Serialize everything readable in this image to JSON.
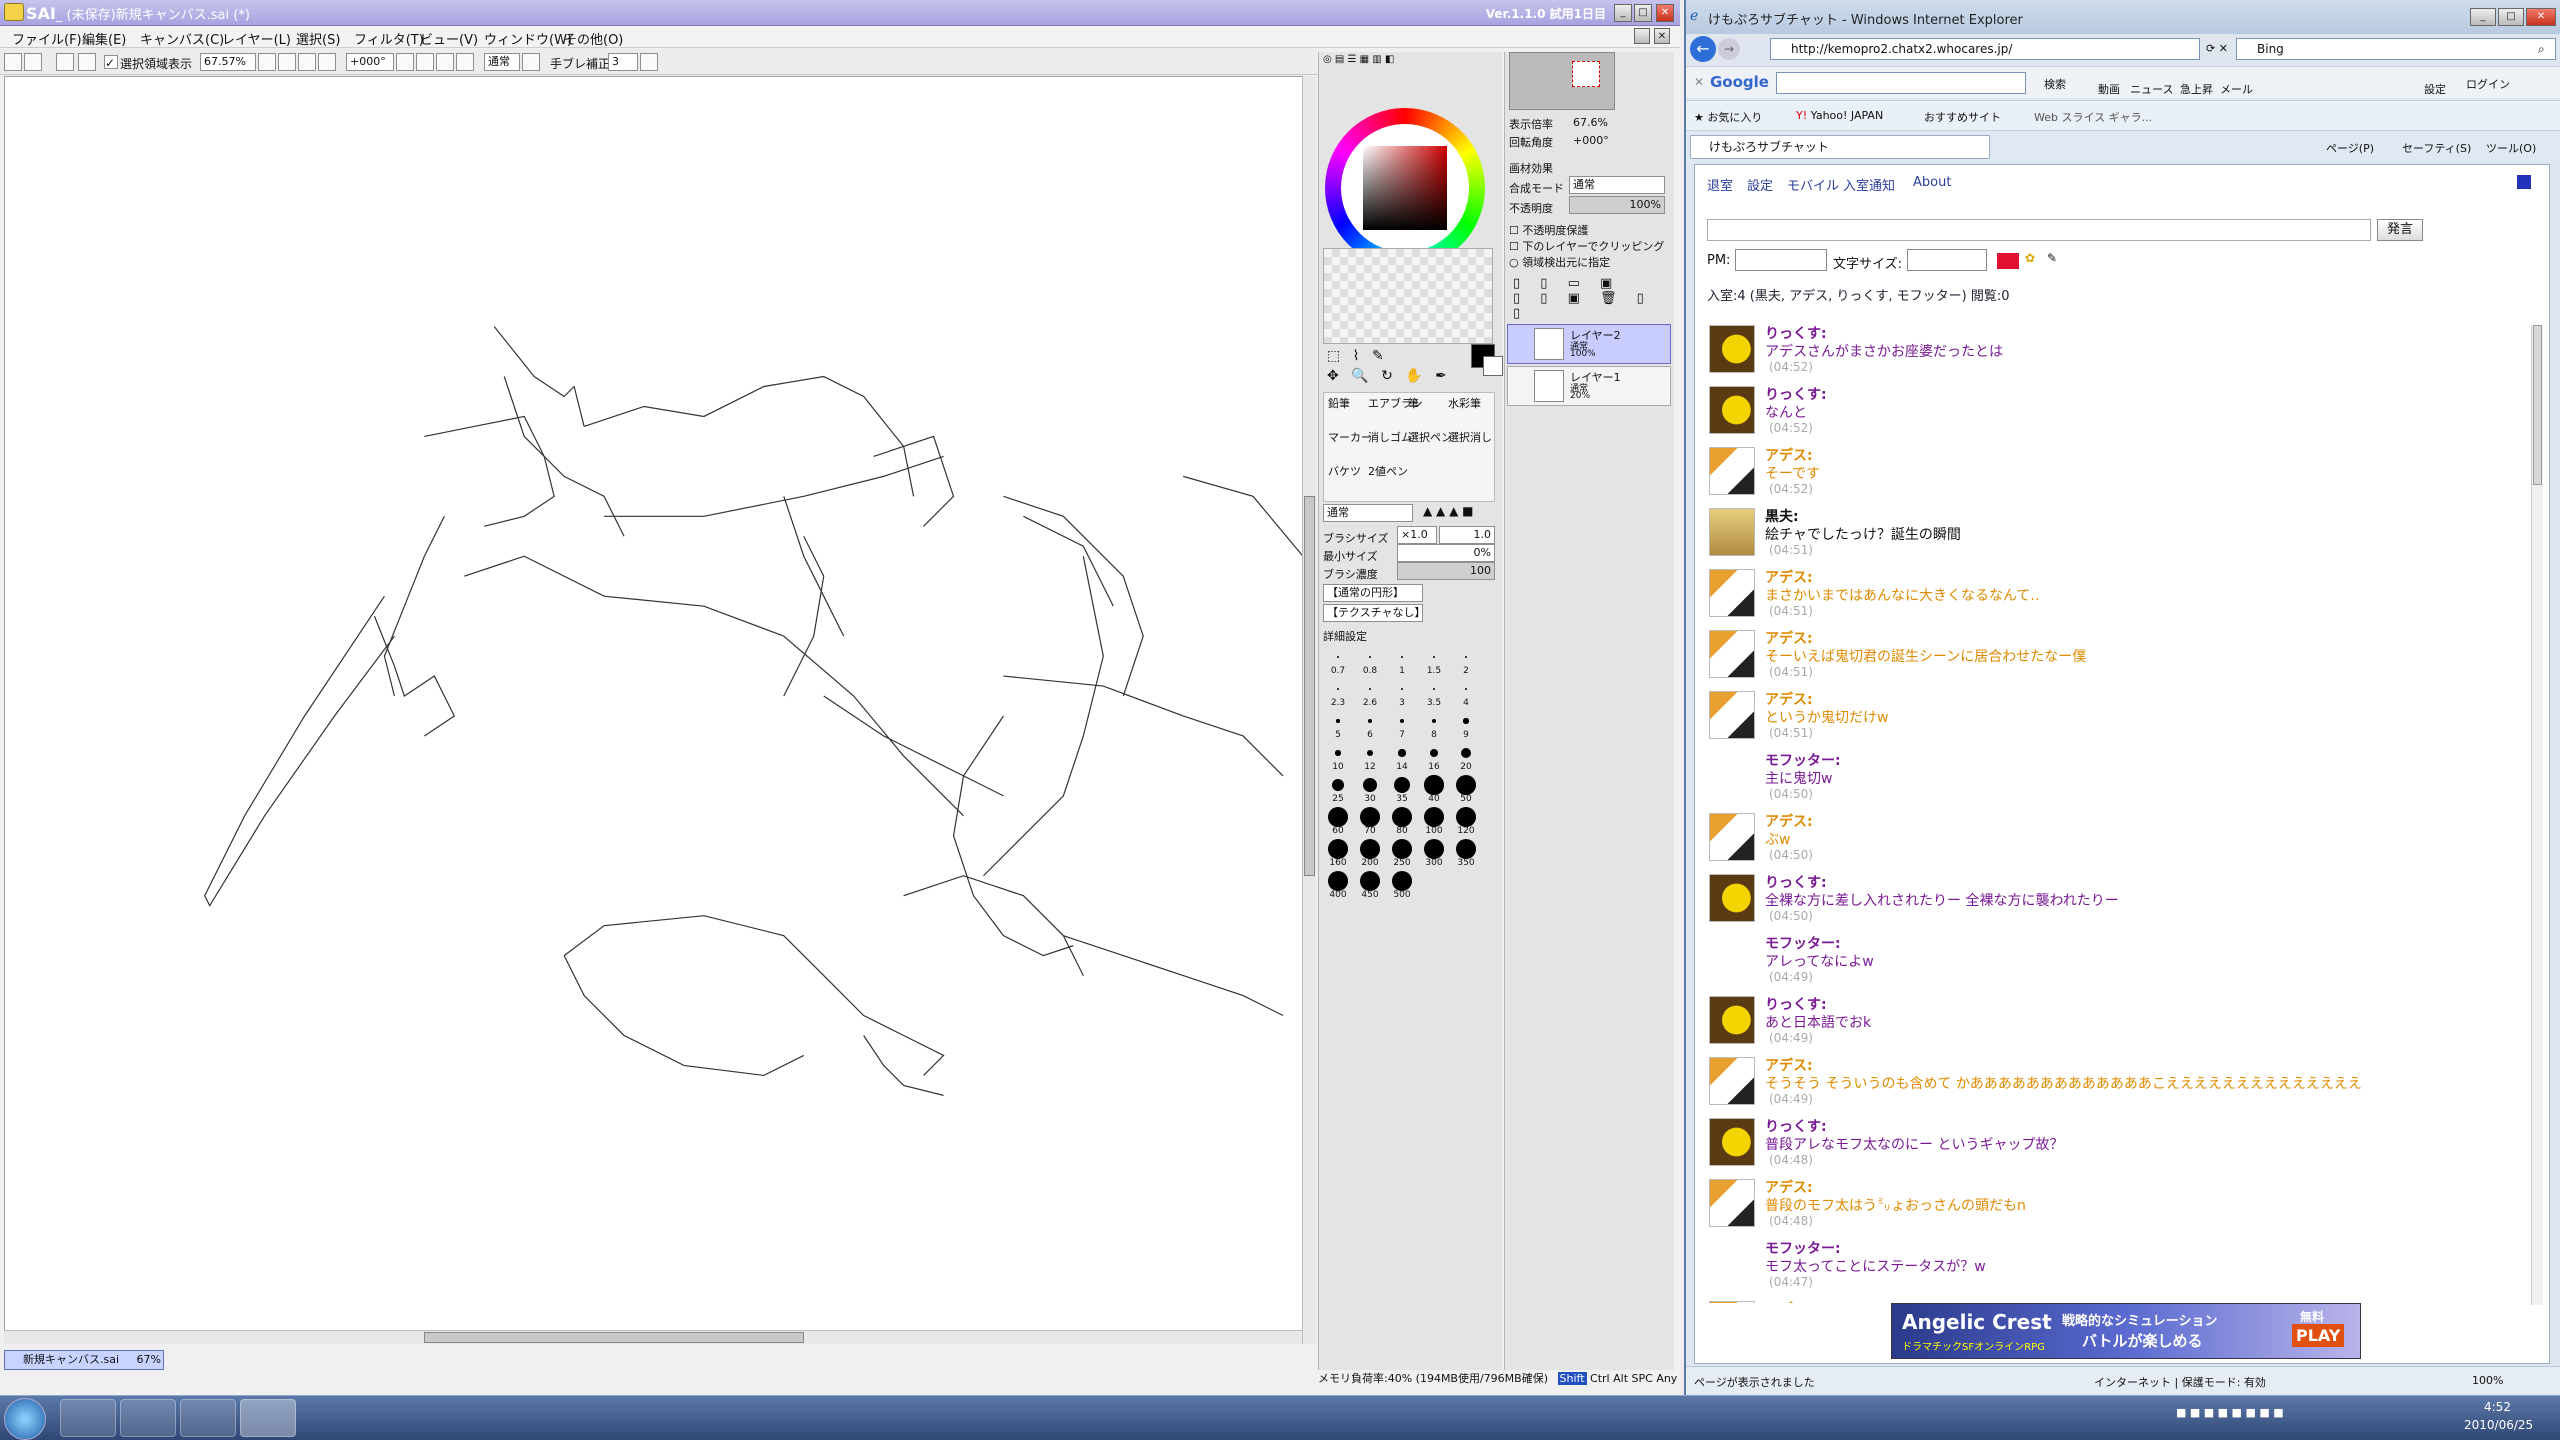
{
  "sai": {
    "title": "(未保存)新規キャンバス.sai (*)",
    "logo_text": "SAI",
    "version": "Ver.1.1.0 試用1日目",
    "menu": [
      "ファイル(F)",
      "編集(E)",
      "キャンバス(C)",
      "レイヤー(L)",
      "選択(S)",
      "フィルタ(T)",
      "ビュー(V)",
      "ウィンドウ(W)",
      "その他(O)"
    ],
    "toolbar": {
      "selection_show": "選択領域表示",
      "zoom": "67.57%",
      "angle": "+000°",
      "blend": "通常",
      "stabilizer_label": "手ブレ補正",
      "stabilizer_value": "3"
    },
    "nav": {
      "display_scale_label": "表示倍率",
      "display_scale": "67.6%",
      "rotation_label": "回転角度",
      "rotation": "+000°"
    },
    "layer_props": {
      "paper_effect": "画材効果",
      "blend_label": "合成モード",
      "blend": "通常",
      "opacity_label": "不透明度",
      "opacity": "100%",
      "preserve_opacity": "不透明度保護",
      "clip": "下のレイヤーでクリッピング",
      "select_source": "領域検出元に指定"
    },
    "layers": [
      {
        "name": "レイヤー2",
        "mode": "通常",
        "opacity": "100%"
      },
      {
        "name": "レイヤー1",
        "mode": "通常",
        "opacity": "20%"
      }
    ],
    "tools": [
      "鉛筆",
      "エアブラシ",
      "筆",
      "水彩筆",
      "マーカー",
      "消しゴム",
      "選択ペン",
      "選択消し",
      "バケツ",
      "2値ペン"
    ],
    "brush": {
      "mode": "通常",
      "size_label": "ブラシサイズ",
      "size_mult": "×1.0",
      "size": "1.0",
      "min_label": "最小サイズ",
      "min": "0%",
      "density_label": "ブラシ濃度",
      "density": "100",
      "shape": "【通常の円形】",
      "texture": "【テクスチャなし】",
      "detail": "詳細設定"
    },
    "sizes": [
      "0.7",
      "0.8",
      "1",
      "1.5",
      "2",
      "2.3",
      "2.6",
      "3",
      "3.5",
      "4",
      "5",
      "6",
      "7",
      "8",
      "9",
      "10",
      "12",
      "14",
      "16",
      "20",
      "25",
      "30",
      "35",
      "40",
      "50",
      "60",
      "70",
      "80",
      "100",
      "120",
      "160",
      "200",
      "250",
      "300",
      "350",
      "400",
      "450",
      "500"
    ],
    "tab_name": "新規キャンバス.sai",
    "tab_zoom": "67%",
    "memory": "メモリ負荷率:40% (194MB使用/796MB確保)",
    "status_keys": [
      "Shift",
      "Ctrl",
      "Alt",
      "SPC",
      "Any"
    ]
  },
  "ie": {
    "title": "けもぷろサブチャット - Windows Internet Explorer",
    "url": "http://kemopro2.chatx2.whocares.jp/",
    "search_engine": "Bing",
    "google": "Google",
    "gbar": [
      "検索",
      "動画",
      "ニュース",
      "急上昇",
      "メール",
      "設定",
      "ログイン"
    ],
    "favorites": [
      "お気に入り",
      "Yahoo! JAPAN",
      "おすすめサイト",
      "Web スライス ギャラ..."
    ],
    "tab_title": "けもぷろサブチャット",
    "cmdbar": [
      "ページ(P)",
      "セーフティ(S)",
      "ツール(O)"
    ],
    "chat_nav": [
      "退室",
      "設定",
      "モバイル",
      "入室通知",
      "About"
    ],
    "send_label": "発言",
    "pm_label": "PM:",
    "fontsize_label": "文字サイズ:",
    "presence": "入室:4 (黒夫, アデス, りっくす, モフッター) 閲覧:0",
    "messages": [
      {
        "name": "りっくす:",
        "text": "アデスさんがまさかお座婆だったとは",
        "time": "(04:52)",
        "color": "#7a1a94",
        "avatar": "yellow"
      },
      {
        "name": "りっくす:",
        "text": "なんと",
        "time": "(04:52)",
        "color": "#7a1a94",
        "avatar": "yellow"
      },
      {
        "name": "アデス:",
        "text": "そーです",
        "time": "(04:52)",
        "color": "#e08a00",
        "avatar": "horse"
      },
      {
        "name": "黒夫:",
        "text": "絵チャでしたっけ？誕生の瞬間",
        "time": "(04:51)",
        "color": "#111111",
        "avatar": "blonde"
      },
      {
        "name": "アデス:",
        "text": "まさかいまではあんなに大きくなるなんて‥",
        "time": "(04:51)",
        "color": "#e08a00",
        "avatar": "horse"
      },
      {
        "name": "アデス:",
        "text": "そーいえば鬼切君の誕生シーンに居合わせたなー僕",
        "time": "(04:51)",
        "color": "#e08a00",
        "avatar": "horse"
      },
      {
        "name": "アデス:",
        "text": "というか鬼切だけw",
        "time": "(04:51)",
        "color": "#e08a00",
        "avatar": "horse"
      },
      {
        "name": "モフッター:",
        "text": "主に鬼切w",
        "time": "(04:50)",
        "color": "#7a1a94",
        "avatar": "none"
      },
      {
        "name": "アデス:",
        "text": "ぶw",
        "time": "(04:50)",
        "color": "#e08a00",
        "avatar": "horse"
      },
      {
        "name": "りっくす:",
        "text": "全裸な方に差し入れされたりー 全裸な方に襲われたりー",
        "time": "(04:50)",
        "color": "#7a1a94",
        "avatar": "yellow"
      },
      {
        "name": "モフッター:",
        "text": "アレってなによw",
        "time": "(04:49)",
        "color": "#7a1a94",
        "avatar": "none"
      },
      {
        "name": "りっくす:",
        "text": "あと日本語でおk",
        "time": "(04:49)",
        "color": "#7a1a94",
        "avatar": "yellow"
      },
      {
        "name": "アデス:",
        "text": "そうそう そういうのも含めて かあああああああああああああこええええええええええええええ",
        "time": "(04:49)",
        "color": "#e08a00",
        "avatar": "horse"
      },
      {
        "name": "りっくす:",
        "text": "普段アレなモフ太なのにー というギャップ故？",
        "time": "(04:48)",
        "color": "#7a1a94",
        "avatar": "yellow"
      },
      {
        "name": "アデス:",
        "text": "普段のモフ太はう㍉ょおっさんの頭だもn",
        "time": "(04:48)",
        "color": "#e08a00",
        "avatar": "horse"
      },
      {
        "name": "モフッター:",
        "text": "モフ太ってことにステータスが？w",
        "time": "(04:47)",
        "color": "#7a1a94",
        "avatar": "none"
      },
      {
        "name": "アデス:",
        "text": "",
        "time": "",
        "color": "#e08a00",
        "avatar": "horse"
      }
    ],
    "ad": {
      "title": "Angelic Crest",
      "sub": "ドラマチックSFオンラインRPG",
      "catch1": "戦略的なシミュレーション",
      "catch2": "バトルが楽しめる",
      "badge": "無料",
      "play": "PLAY"
    },
    "status_text": "ページが表示されました",
    "zone": "インターネット | 保護モード: 有効",
    "zoom": "100%"
  },
  "taskbar": {
    "time": "4:52",
    "date": "2010/06/25"
  }
}
